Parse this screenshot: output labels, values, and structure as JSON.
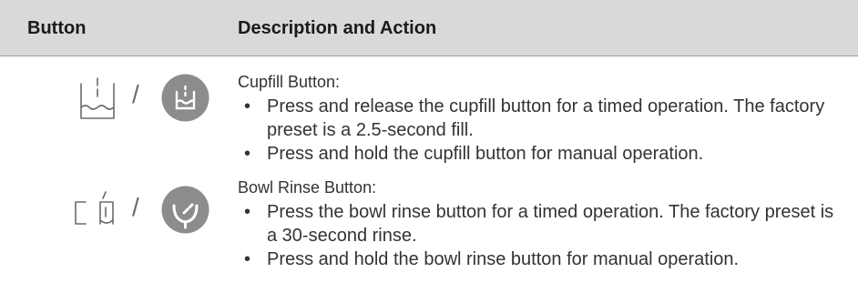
{
  "header": {
    "col_button": "Button",
    "col_description": "Description and Action"
  },
  "rows": [
    {
      "title": "Cupfill Button:",
      "bullets": [
        "Press and release the cupfill button for a timed operation. The factory preset is a 2.5-second fill.",
        "Press and hold the cupfill button for manual operation."
      ],
      "separator": "/",
      "icons": [
        "cupfill-outline-icon",
        "cupfill-circle-icon"
      ]
    },
    {
      "title": "Bowl Rinse Button:",
      "bullets": [
        "Press the bowl rinse button for a timed operation. The factory preset is a 30-second rinse.",
        "Press and hold the bowl rinse button for manual operation."
      ],
      "separator": "/",
      "icons": [
        "bowl-rinse-outline-icon",
        "bowl-rinse-circle-icon"
      ]
    }
  ],
  "bullet_glyph": "•",
  "colors": {
    "header_bg": "#d9d9d9",
    "icon_circle": "#8c8c8c",
    "icon_line": "#6b6b6b",
    "text": "#333333"
  }
}
